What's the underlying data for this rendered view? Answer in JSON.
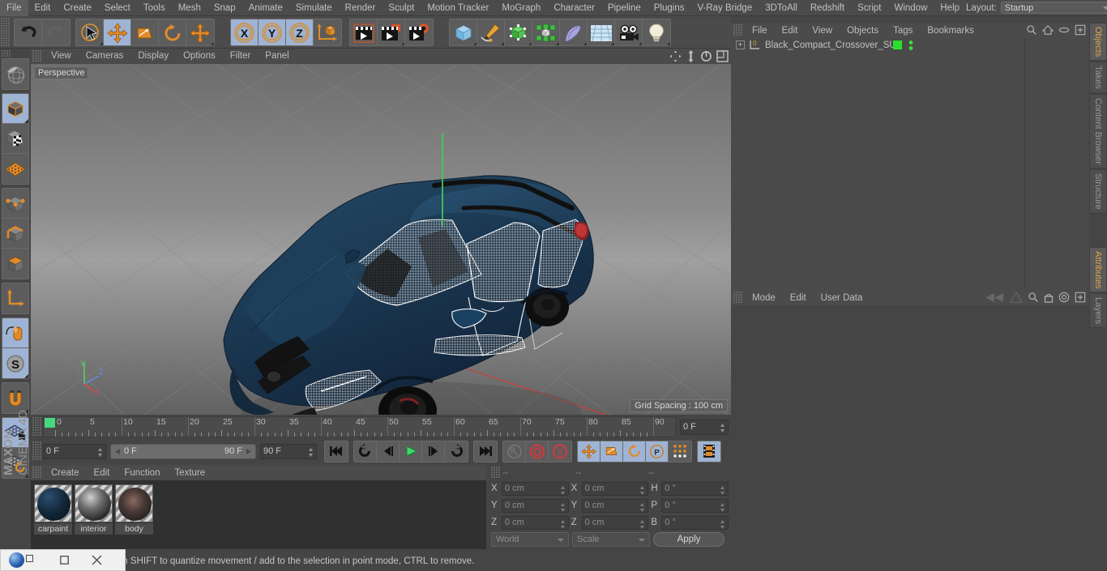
{
  "app": {
    "name": "MAXON CINEMA 4D",
    "brand_line1": "MAXON",
    "brand_line2": "CINEMA 4D"
  },
  "menubar": {
    "items": [
      {
        "label": "File"
      },
      {
        "label": "Edit"
      },
      {
        "label": "Create"
      },
      {
        "label": "Select"
      },
      {
        "label": "Tools"
      },
      {
        "label": "Mesh"
      },
      {
        "label": "Snap"
      },
      {
        "label": "Animate"
      },
      {
        "label": "Simulate"
      },
      {
        "label": "Render"
      },
      {
        "label": "Sculpt"
      },
      {
        "label": "Motion Tracker"
      },
      {
        "label": "MoGraph"
      },
      {
        "label": "Character"
      },
      {
        "label": "Pipeline"
      },
      {
        "label": "Plugins"
      },
      {
        "label": "V-Ray Bridge"
      },
      {
        "label": "3DToAll"
      },
      {
        "label": "Redshift"
      },
      {
        "label": "Script"
      },
      {
        "label": "Window"
      },
      {
        "label": "Help"
      }
    ],
    "layout_label": "Layout:",
    "layout_value": "Startup",
    "search_icon": "magnifier-icon"
  },
  "toolbar": {
    "groups": [
      {
        "buttons": [
          {
            "name": "undo-button",
            "icon": "undo-arrow-icon",
            "state": "normal"
          },
          {
            "name": "redo-button",
            "icon": "redo-arrow-icon",
            "state": "disabled"
          }
        ]
      },
      {
        "buttons": [
          {
            "name": "live-selection-tool",
            "icon": "cursor-circle-icon",
            "state": "normal"
          },
          {
            "name": "move-tool",
            "icon": "move-arrows-icon",
            "state": "active"
          },
          {
            "name": "scale-tool",
            "icon": "scale-box-icon",
            "state": "normal"
          },
          {
            "name": "rotate-tool",
            "icon": "rotate-arc-icon",
            "state": "normal"
          },
          {
            "name": "transform-tool",
            "icon": "move-arrows-icon",
            "state": "normal"
          }
        ]
      },
      {
        "buttons": [
          {
            "name": "axis-x-toggle",
            "icon": "x-axis-icon",
            "label": "X",
            "state": "active"
          },
          {
            "name": "axis-y-toggle",
            "icon": "y-axis-icon",
            "label": "Y",
            "state": "active"
          },
          {
            "name": "axis-z-toggle",
            "icon": "z-axis-icon",
            "label": "Z",
            "state": "active"
          },
          {
            "name": "world-object-coordinates-toggle",
            "icon": "axis-cube-icon",
            "state": "normal"
          }
        ]
      },
      {
        "buttons": [
          {
            "name": "render-view-button",
            "icon": "clapperboard-icon",
            "state": "normal"
          },
          {
            "name": "render-region-button",
            "icon": "clapperboard-region-icon",
            "state": "normal"
          },
          {
            "name": "render-settings-button",
            "icon": "clapperboard-gear-icon",
            "state": "normal"
          }
        ]
      },
      {
        "buttons": [
          {
            "name": "primitive-cube-button",
            "icon": "blue-cube-icon",
            "state": "normal"
          },
          {
            "name": "spline-pen-button",
            "icon": "pen-spline-icon",
            "state": "normal"
          },
          {
            "name": "generator-button",
            "icon": "green-cube-icon",
            "state": "normal"
          },
          {
            "name": "mograph-button",
            "icon": "cloner-icon",
            "state": "normal"
          },
          {
            "name": "deformer-button",
            "icon": "bend-deformer-icon",
            "state": "normal"
          },
          {
            "name": "scene-environment-button",
            "icon": "floor-grid-icon",
            "state": "normal"
          },
          {
            "name": "camera-button",
            "icon": "camera-icon",
            "state": "normal"
          },
          {
            "name": "light-button",
            "icon": "lightbulb-icon",
            "state": "normal"
          }
        ]
      }
    ]
  },
  "left_toolbar": {
    "groups": [
      {
        "buttons": [
          {
            "name": "undo-view-button",
            "icon": "globe-sphere-icon",
            "state": "normal"
          }
        ]
      },
      {
        "buttons": [
          {
            "name": "model-mode-button",
            "icon": "solid-cube-icon",
            "state": "active"
          },
          {
            "name": "texture-mode-button",
            "icon": "checker-cube-icon",
            "state": "normal"
          },
          {
            "name": "workplane-mode-button",
            "icon": "orange-grid-plane-icon",
            "state": "normal"
          }
        ]
      },
      {
        "buttons": [
          {
            "name": "points-mode-button",
            "icon": "points-cube-icon",
            "state": "normal"
          },
          {
            "name": "edges-mode-button",
            "icon": "edges-cube-icon",
            "state": "normal"
          },
          {
            "name": "polygons-mode-button",
            "icon": "polygons-cube-icon",
            "state": "normal"
          }
        ]
      },
      {
        "buttons": [
          {
            "name": "enable-axis-button",
            "icon": "axis-l-icon",
            "state": "normal"
          }
        ]
      },
      {
        "buttons": [
          {
            "name": "viewport-solo-button",
            "icon": "mouse-icon",
            "state": "active"
          },
          {
            "name": "snap-settings-button",
            "icon": "s-compass-icon",
            "state": "active"
          }
        ]
      },
      {
        "buttons": [
          {
            "name": "magnet-tool-button",
            "icon": "magnet-icon",
            "state": "normal"
          }
        ]
      },
      {
        "buttons": [
          {
            "name": "lock-workplane-button",
            "icon": "grid-lock-icon",
            "state": "active"
          },
          {
            "name": "planar-workplane-button",
            "icon": "grid-rotate-icon",
            "state": "normal"
          }
        ]
      }
    ]
  },
  "viewport": {
    "menu": [
      {
        "label": "View"
      },
      {
        "label": "Cameras"
      },
      {
        "label": "Display"
      },
      {
        "label": "Options"
      },
      {
        "label": "Filter"
      },
      {
        "label": "Panel"
      }
    ],
    "view_label": "Perspective",
    "grid_spacing": "Grid Spacing : 100 cm",
    "nav_icons": [
      {
        "name": "pan-view-icon"
      },
      {
        "name": "zoom-view-icon"
      },
      {
        "name": "rotate-view-icon"
      },
      {
        "name": "maximize-view-icon"
      }
    ],
    "axis_gizmo": {
      "y_label": "Y",
      "z_label": "Z",
      "x_label": "X",
      "y_color": "#58d45c",
      "z_color": "#5f8fe0",
      "x_color": "#e04a4a"
    },
    "model": {
      "name": "Black_Compact_Crossover_SUV",
      "body_color": "#1c3a54",
      "selected": true
    }
  },
  "timeline": {
    "ruler_min": 0,
    "ruler_max": 90,
    "tick_labels": [
      0,
      5,
      10,
      15,
      20,
      25,
      30,
      35,
      40,
      45,
      50,
      55,
      60,
      65,
      70,
      75,
      80,
      85,
      90
    ],
    "current_frame_field": "0 F",
    "playhead_frame": 0,
    "playhead_color": "#49d97d"
  },
  "playback": {
    "current_frame": "0 F",
    "range_start": "0 F",
    "range_end": "90 F",
    "end_frame": "90 F",
    "buttons": [
      {
        "name": "go-to-start-button",
        "icon": "skip-start-icon",
        "state": "normal"
      },
      {
        "name": "play-backwards-rewind-button",
        "icon": "rewind-loop-icon",
        "state": "normal"
      },
      {
        "name": "previous-frame-button",
        "icon": "step-back-icon",
        "state": "normal"
      },
      {
        "name": "play-forward-button",
        "icon": "play-triangle-icon",
        "state": "normal"
      },
      {
        "name": "next-frame-button",
        "icon": "step-forward-icon",
        "state": "normal"
      },
      {
        "name": "loop-button",
        "icon": "loop-arrow-icon",
        "state": "normal"
      },
      {
        "name": "go-to-end-button",
        "icon": "skip-end-icon",
        "state": "normal"
      },
      {
        "name": "record-keyframe-button",
        "icon": "key-icon",
        "state": "disabled"
      },
      {
        "name": "autokeying-button",
        "icon": "red-ring-icon",
        "state": "normal"
      },
      {
        "name": "keyframe-selection-button",
        "icon": "red-question-icon",
        "state": "normal"
      },
      {
        "name": "record-position-button",
        "icon": "move-arrows-icon",
        "state": "active"
      },
      {
        "name": "record-scale-button",
        "icon": "scale-box-icon",
        "state": "active"
      },
      {
        "name": "record-rotation-button",
        "icon": "rotate-arc-icon",
        "state": "active"
      },
      {
        "name": "record-pla-button",
        "icon": "p-ring-icon",
        "state": "active"
      },
      {
        "name": "point-level-animation-button",
        "icon": "dots-grid-icon",
        "state": "normal"
      },
      {
        "name": "timeline-view-button",
        "icon": "film-strip-icon",
        "state": "active"
      }
    ]
  },
  "material_manager": {
    "menu": [
      {
        "label": "Create"
      },
      {
        "label": "Edit"
      },
      {
        "label": "Function"
      },
      {
        "label": "Texture"
      }
    ],
    "materials": [
      {
        "name": "carpaint",
        "color": "#122637"
      },
      {
        "name": "interior",
        "color": "#585858"
      },
      {
        "name": "body",
        "color": "#4a4a4a"
      }
    ]
  },
  "coordinate_manager": {
    "col_headers": [
      "--",
      "--",
      "--"
    ],
    "rows": [
      {
        "pos_label": "X",
        "pos_value": "0 cm",
        "size_label": "X",
        "size_value": "0 cm",
        "rot_label": "H",
        "rot_value": "0 °"
      },
      {
        "pos_label": "Y",
        "pos_value": "0 cm",
        "size_label": "Y",
        "size_value": "0 cm",
        "rot_label": "P",
        "rot_value": "0 °"
      },
      {
        "pos_label": "Z",
        "pos_value": "0 cm",
        "size_label": "Z",
        "size_value": "0 cm",
        "rot_label": "B",
        "rot_value": "0 °"
      }
    ],
    "space_dropdown": "World",
    "mode_dropdown": "Scale",
    "apply_label": "Apply"
  },
  "object_manager": {
    "menu": [
      {
        "label": "File"
      },
      {
        "label": "Edit"
      },
      {
        "label": "View"
      },
      {
        "label": "Objects"
      },
      {
        "label": "Tags"
      },
      {
        "label": "Bookmarks"
      }
    ],
    "icons": [
      {
        "name": "search-icon"
      },
      {
        "name": "home-icon"
      },
      {
        "name": "ellipse-icon"
      },
      {
        "name": "new-layer-icon"
      }
    ],
    "objects": [
      {
        "name": "Black_Compact_Crossover_SUV",
        "icon": "null-object-icon",
        "expandable": true,
        "tag_color": "#2ae02a",
        "visibility_dots": 2
      }
    ]
  },
  "attribute_manager": {
    "menu": [
      {
        "label": "Mode"
      },
      {
        "label": "Edit"
      },
      {
        "label": "User Data"
      }
    ],
    "icons": [
      {
        "name": "back-nav-icon"
      },
      {
        "name": "forward-nav-icon"
      },
      {
        "name": "search-icon"
      },
      {
        "name": "lock-icon"
      },
      {
        "name": "target-icon"
      },
      {
        "name": "new-tab-icon"
      }
    ]
  },
  "right_tabs": {
    "top_group": [
      {
        "label": "Objects",
        "active": true
      },
      {
        "label": "Takes",
        "active": false
      },
      {
        "label": "Content Browser",
        "active": false
      },
      {
        "label": "Structure",
        "active": false
      }
    ],
    "bottom_group": [
      {
        "label": "Attributes",
        "active": true
      },
      {
        "label": "Layers",
        "active": false
      }
    ]
  },
  "status_bar": {
    "message": "move elements. Hold down SHIFT to quantize movement / add to the selection in point mode, CTRL to remove."
  },
  "window_controls": {
    "restore_label": "❐",
    "close_label": "✕",
    "logo_icon": "c4d-logo-icon"
  },
  "colors": {
    "accent_orange": "#e08b2a",
    "active_blue": "#9fb4d4",
    "panel_bg": "#454545",
    "toolbar_bg": "#4b4b4b",
    "green_tag": "#2ae02a"
  }
}
